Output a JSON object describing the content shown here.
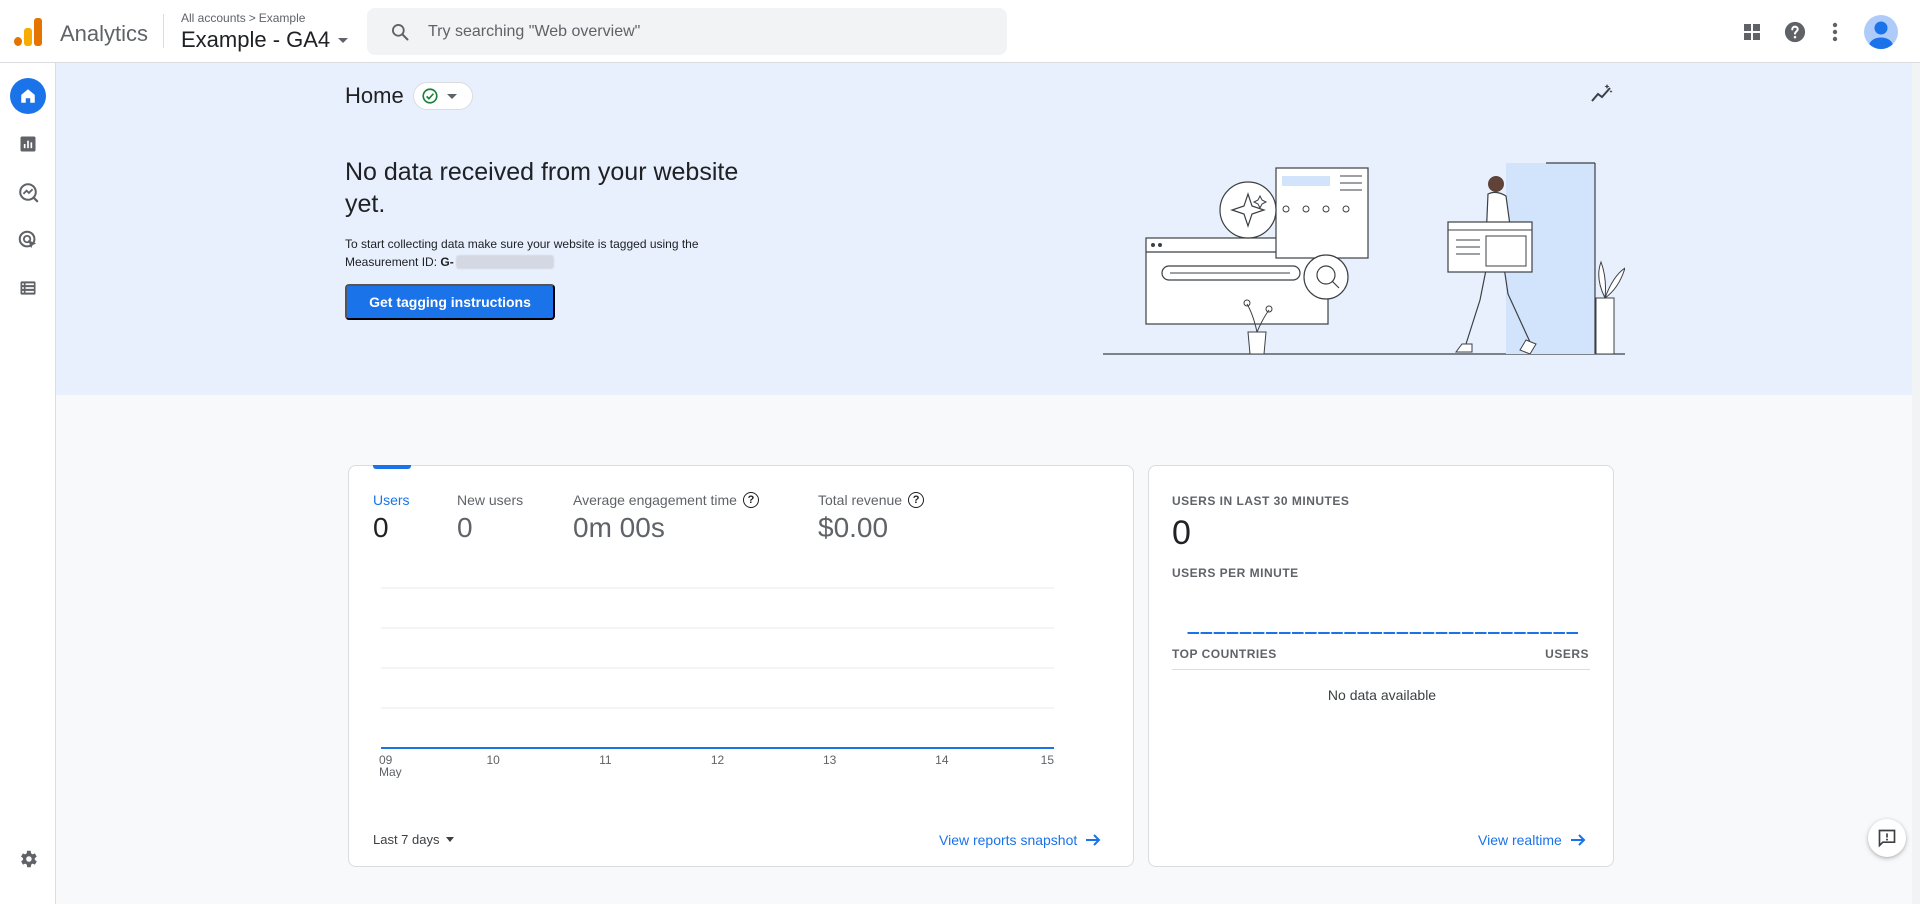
{
  "header": {
    "product_name": "Analytics",
    "breadcrumb": {
      "root": "All accounts",
      "separator": ">",
      "account": "Example"
    },
    "property": "Example - GA4",
    "search_placeholder": "Try searching \"Web overview\""
  },
  "nav": {
    "items": [
      {
        "icon": "home-icon",
        "active": true
      },
      {
        "icon": "bar-chart-icon",
        "active": false
      },
      {
        "icon": "explore-icon",
        "active": false
      },
      {
        "icon": "advertising-icon",
        "active": false
      },
      {
        "icon": "list-icon",
        "active": false
      }
    ],
    "admin_icon": "gear-icon"
  },
  "hero": {
    "page_title": "Home",
    "heading": "No data received from your website yet.",
    "text": "To start collecting data make sure your website is tagged using the Measurement ID:",
    "measurement_id_prefix": "G-",
    "cta_label": "Get tagging instructions"
  },
  "overview": {
    "metrics": [
      {
        "label": "Users",
        "value": "0",
        "active": true,
        "help": false
      },
      {
        "label": "New users",
        "value": "0",
        "active": false,
        "help": false
      },
      {
        "label": "Average engagement time",
        "value": "0m 00s",
        "active": false,
        "help": true
      },
      {
        "label": "Total revenue",
        "value": "$0.00",
        "active": false,
        "help": true
      }
    ],
    "date_range": "Last 7 days",
    "link_label": "View reports snapshot"
  },
  "chart_data": {
    "type": "line",
    "x": [
      "09",
      "10",
      "11",
      "12",
      "13",
      "14",
      "15"
    ],
    "x_sublabel": "May",
    "series": [
      {
        "name": "Users",
        "values": [
          0,
          0,
          0,
          0,
          0,
          0,
          0
        ]
      }
    ],
    "ylim": [
      0,
      4
    ],
    "grid": true,
    "color": "#1a73e8"
  },
  "realtime": {
    "users_label": "USERS IN LAST 30 MINUTES",
    "users_value": "0",
    "per_minute_label": "USERS PER MINUTE",
    "countries_header": "TOP COUNTRIES",
    "users_header": "USERS",
    "empty_text": "No data available",
    "link_label": "View realtime"
  },
  "colors": {
    "accent": "#1a73e8",
    "hero_bg": "#e8f0fe",
    "success": "#188038"
  }
}
